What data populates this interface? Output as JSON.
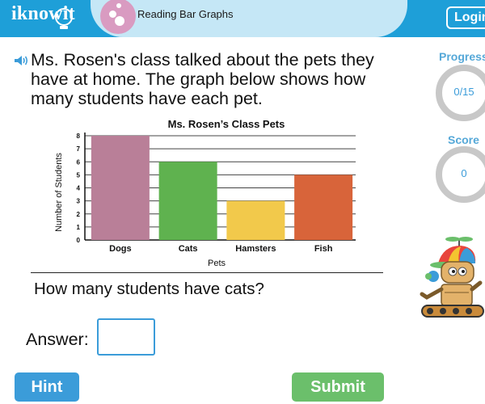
{
  "header": {
    "logo": "iknowit",
    "lesson_title": "Reading Bar Graphs",
    "login_label": "Login"
  },
  "question": {
    "prompt": "Ms. Rosen's class talked about the pets they have at home. The graph below shows how many students have each pet.",
    "ask": "How many students have cats?",
    "answer_label": "Answer:",
    "answer_value": ""
  },
  "buttons": {
    "hint": "Hint",
    "submit": "Submit"
  },
  "sidebar": {
    "progress_label": "Progress",
    "progress_value": "0/15",
    "score_label": "Score",
    "score_value": "0"
  },
  "colors": {
    "brand_blue": "#1e9fd8",
    "accent_blue": "#3b9cd9",
    "submit_green": "#6bbf6b"
  },
  "chart_data": {
    "type": "bar",
    "title": "Ms. Rosen’s Class Pets",
    "xlabel": "Pets",
    "ylabel": "Number of Students",
    "categories": [
      "Dogs",
      "Cats",
      "Hamsters",
      "Fish"
    ],
    "values": [
      8,
      6,
      3,
      5
    ],
    "colors": [
      "#b97f98",
      "#5fb24f",
      "#f2c94b",
      "#d8643a"
    ],
    "ylim": [
      0,
      8
    ],
    "yticks": [
      0,
      1,
      2,
      3,
      4,
      5,
      6,
      7,
      8
    ],
    "grid": true,
    "legend": "none"
  }
}
